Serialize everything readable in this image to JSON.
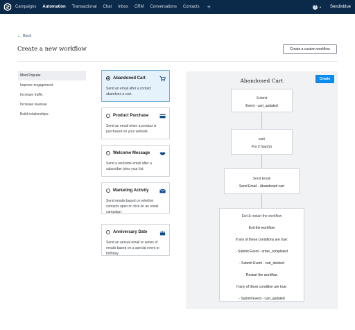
{
  "nav": {
    "items": [
      "Campaigns",
      "Automation",
      "Transactional",
      "Chat",
      "Inbox",
      "CRM",
      "Conversations",
      "Contacts"
    ],
    "active_index": 1,
    "plus": "+",
    "help": "?",
    "account": "Sendinblue"
  },
  "header": {
    "back": "Back",
    "title": "Create a new workflow",
    "custom_button": "Create a custom workflow"
  },
  "sidebar": {
    "items": [
      "Most Popular",
      "Improve engagement",
      "Increase traffic",
      "Increase revenue",
      "Build relationships"
    ],
    "active_index": 0
  },
  "templates": [
    {
      "title": "Abandoned Cart",
      "desc": "Send an email after a contact abandons a cart.",
      "selected": true,
      "icon": "cart-icon"
    },
    {
      "title": "Product Purchase",
      "desc": "Send an email when a product is purchased on your website.",
      "selected": false,
      "icon": "credit-card-icon"
    },
    {
      "title": "Welcome Message",
      "desc": "Send a welcome email after a subscriber joins your list.",
      "selected": false,
      "icon": "handshake-icon"
    },
    {
      "title": "Marketing Activity",
      "desc": "Send emails based on whether contacts open or click on an email campaign.",
      "selected": false,
      "icon": "envelope-icon"
    },
    {
      "title": "Anniversary Date",
      "desc": "Send an annual email or series of emails based on a special event or birthday.",
      "selected": false,
      "icon": "birthday-cake-icon"
    }
  ],
  "workflow": {
    "title": "Abandoned Cart",
    "create_button": "Create",
    "steps": [
      {
        "label": "Submit",
        "detail": "Event - cart_updated"
      },
      {
        "label": "wait",
        "detail": "For 2 hour(s)"
      },
      {
        "label": "Send Email",
        "detail": "Send Email - Abandoned cart"
      }
    ],
    "exit_block": {
      "heading": "Exit & restart the workflow",
      "lines": [
        "Exit the workflow",
        "If any of these conditions are true:",
        "- Submit Event - order_completed",
        "- Submit Event - cart_deleted",
        "Restart the workflow",
        "If any of these condition are true:",
        "- Submit Event - cart_updated"
      ]
    }
  },
  "colors": {
    "nav_bg": "#0b2a4a",
    "primary_button": "#0a8bf0",
    "selected_card_bg": "#e6f2fb",
    "selected_card_border": "#6aaed6",
    "panel_bg": "#f0f2f4"
  }
}
